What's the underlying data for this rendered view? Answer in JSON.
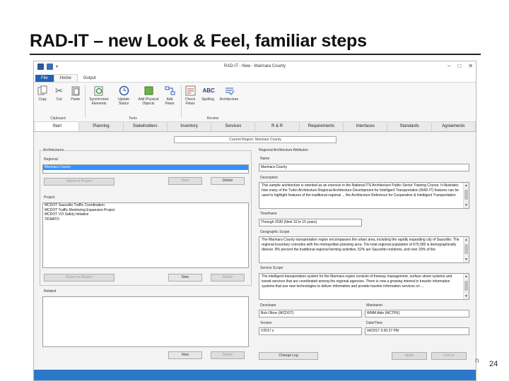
{
  "slide": {
    "title": "RAD-IT – new Look & Feel, familiar steps",
    "number": "24",
    "footer_glyph": "n"
  },
  "window": {
    "title": "RAD-IT - New - Marinara County",
    "controls": [
      "–",
      "□",
      "✕"
    ]
  },
  "menu_tabs": {
    "file": "File",
    "home": "Home",
    "output": "Output"
  },
  "ribbon": {
    "clipboard": {
      "name": "Clipboard",
      "items": [
        "Copy",
        "Cut",
        "Paste"
      ]
    },
    "tools": {
      "name": "Tools",
      "items": [
        "Synchronize Elements",
        "Update Status",
        "Add Physical Objects",
        "Add Flows"
      ]
    },
    "review": {
      "name": "Review",
      "items": [
        "Check Flows",
        "Spelling",
        "Architecture"
      ]
    },
    "icons": [
      "copy-icon",
      "cut-icon",
      "paste-icon",
      "synchronize-icon",
      "update-status-icon",
      "add-physical-objects-icon",
      "add-flows-icon",
      "check-flows-icon",
      "spelling-icon",
      "architecture-icon"
    ]
  },
  "tabs": [
    "Start",
    "Planning",
    "Stakeholders",
    "Inventory",
    "Services",
    "R & R",
    "Requirements",
    "Interfaces",
    "Standards",
    "Agreements"
  ],
  "active_tab": "Start",
  "current_region": "Current Region: Marinara County",
  "left": {
    "architectures_label": "Architectures",
    "regional_label": "Regional",
    "regional_items": [
      "Marinara County"
    ],
    "regional_buttons": {
      "import": "Import to Project",
      "new": "New",
      "delete": "Delete"
    },
    "project_label": "Project",
    "project_items": [
      "MCDOT Saucelito Traffic Coordination",
      "MCDOT Traffic Monitoring Expansion Project",
      "MCDOT V2I Safety Initiative",
      "TEWATO"
    ],
    "project_buttons": {
      "export": "Export to Region",
      "new": "New",
      "delete": "Delete"
    },
    "related_label": "Related",
    "related_items": [],
    "related_buttons": {
      "new": "New",
      "delete": "Delete"
    }
  },
  "right": {
    "section_label": "Regional Architecture Attributes",
    "name_label": "Name",
    "name_value": "Marinara County",
    "description_label": "Description",
    "description_value": "This sample architecture is oriented as an exercise in the National ITS Architecture Public Sector Training Course. It illustrates how many of the Turbo Architecture Regional Architecture Development for Intelligent Transportation (RAD-IT) features can be used to highlight features of the traditional regional ... the Architecture Reference for Cooperative & Intelligent Transportation",
    "timeframe_label": "Timeframe",
    "timeframe_value": "Through 2030 (Next 10 to 15 years)",
    "geographic_scope_label": "Geographic Scope",
    "geographic_scope_value": "The Marinara County transportation region encompasses the urban area, including the rapidly expanding city of Saucelito. The regional boundary coincides with the metropolitan planning area. The total regional population of 675,000 is demographically diverse. 8% percent the traditional regional farming activities. 52% are Saucelito residents, and over 20% of the",
    "service_scope_label": "Service Scope",
    "service_scope_value": "The intelligent transportation system for the Marinara region consists of freeway management, surface street systems and transit services that are coordinated among the regional agencies. There is now a growing interest in traveler information systems that use new technologies to deliver information and provide traveler information services on ...",
    "developer_label": "Developer",
    "developer_value": "Bob Olbov (MCDOT)",
    "maintainer_label": "Maintainer",
    "maintainer_value": "WMM Able (MCTPE)",
    "version_label": "Version",
    "version_value": "V2017.s",
    "datetime_label": "Date/Time",
    "datetime_value": "04/2017 3:30:27 PM",
    "buttons": {
      "change_log": "Change Log",
      "apply": "Apply",
      "cancel": "Cancel"
    }
  }
}
